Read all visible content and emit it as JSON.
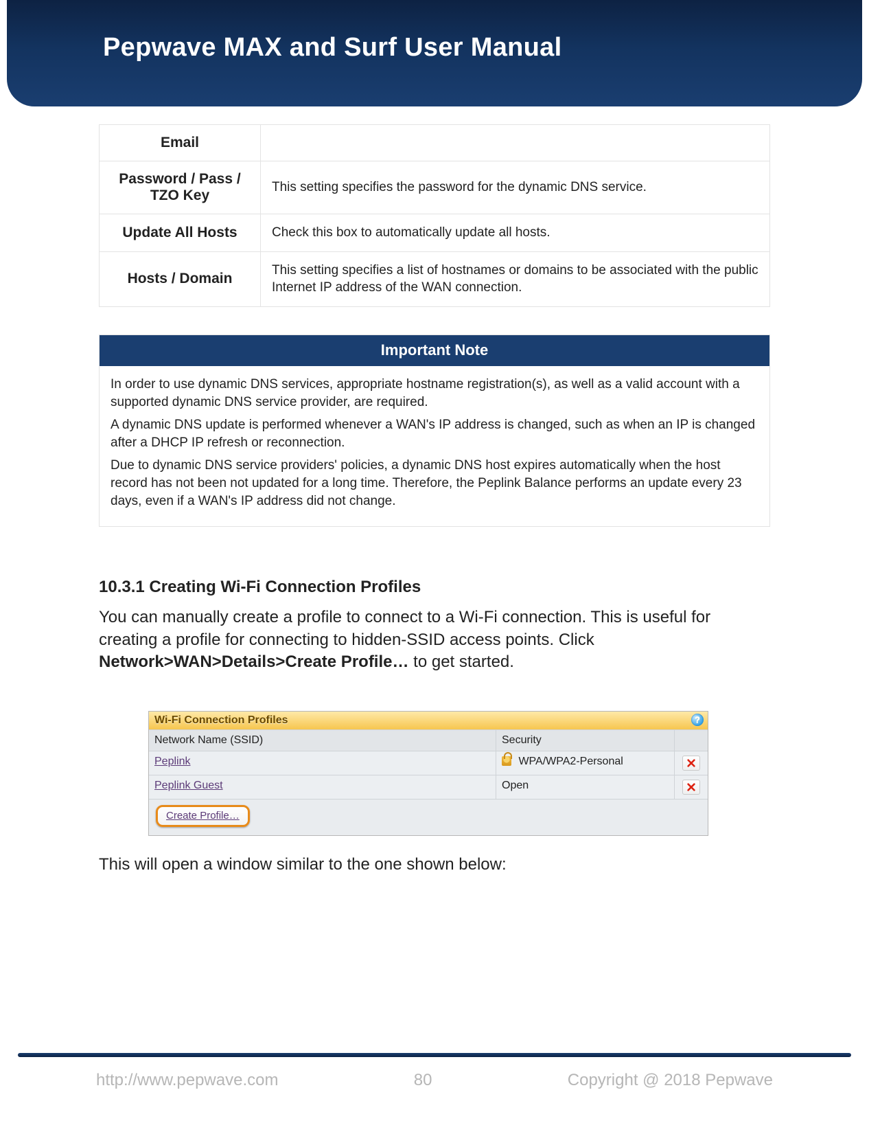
{
  "header": {
    "title": "Pepwave MAX and Surf User Manual"
  },
  "settings_table": {
    "rows": [
      {
        "label": "Email",
        "desc": ""
      },
      {
        "label": "Password / Pass / TZO Key",
        "desc": "This setting specifies the password for the dynamic DNS service."
      },
      {
        "label": "Update All Hosts",
        "desc": "Check this box to automatically update all hosts."
      },
      {
        "label": "Hosts / Domain",
        "desc": "This setting specifies a list of hostnames or domains to be associated with the public Internet IP address of the WAN connection."
      }
    ]
  },
  "note": {
    "title": "Important Note",
    "paragraphs": [
      "In order to use dynamic DNS services, appropriate hostname registration(s), as well as a valid account with a supported dynamic DNS service provider, are required.",
      "A dynamic DNS update is performed whenever a WAN's IP address is changed, such as when an IP is changed after a DHCP IP refresh or reconnection.",
      "Due to dynamic DNS service providers' policies, a dynamic DNS host expires automatically when the host record has not been not updated for a long time. Therefore, the Peplink Balance performs an update every 23 days, even if a WAN's IP address did not change."
    ]
  },
  "section": {
    "number": "10.3.1",
    "title": "Creating Wi-Fi Connection Profiles",
    "intro_before_path": "You can manually create a profile to connect to a Wi-Fi connection. This is useful for creating a profile for connecting to hidden-SSID access points. Click ",
    "path": "Network>WAN>Details>Create Profile…",
    "intro_after_path": " to get started.",
    "after_ui": "This will open a window similar to the one shown below:"
  },
  "wifi_ui": {
    "panel_title": "Wi-Fi Connection Profiles",
    "help_glyph": "?",
    "col_ssid": "Network Name (SSID)",
    "col_security": "Security",
    "rows": [
      {
        "ssid": "Peplink",
        "security": "WPA/WPA2-Personal",
        "locked": true
      },
      {
        "ssid": "Peplink Guest",
        "security": "Open",
        "locked": false
      }
    ],
    "create_label": "Create Profile…"
  },
  "footer": {
    "url": "http://www.pepwave.com",
    "page": "80",
    "copyright": "Copyright @ 2018 Pepwave"
  }
}
